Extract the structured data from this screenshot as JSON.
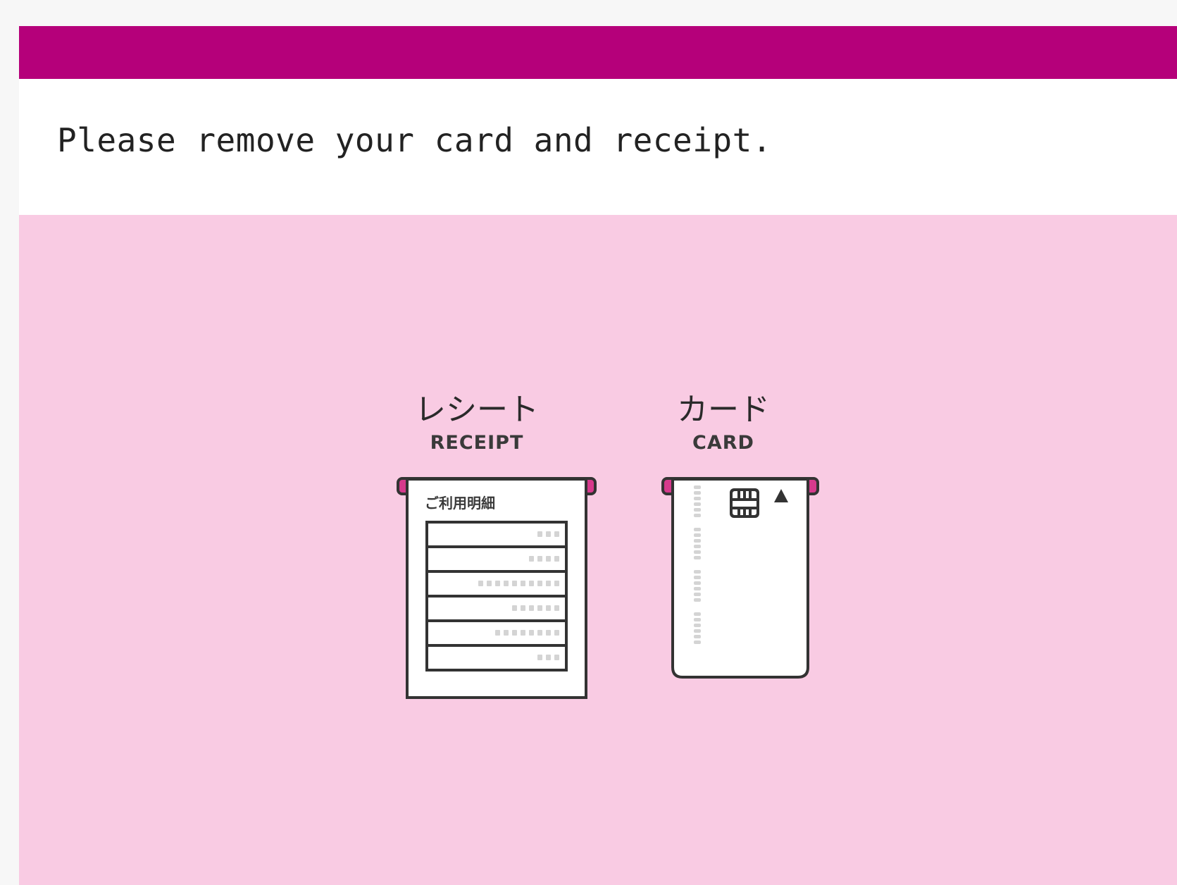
{
  "colors": {
    "header": "#b5007a",
    "content_bg": "#f9cbe3",
    "slot_accent": "#d63a8c",
    "outline": "#333333"
  },
  "message": {
    "text": "Please remove your card and receipt."
  },
  "receipt": {
    "label_ja": "レシート",
    "label_en": "RECEIPT",
    "title": "ご利用明細",
    "icon": "receipt-icon"
  },
  "card": {
    "label_ja": "カード",
    "label_en": "CARD",
    "icon": "card-icon",
    "chip_icon": "chip-icon",
    "arrow_icon": "insert-arrow-icon"
  }
}
